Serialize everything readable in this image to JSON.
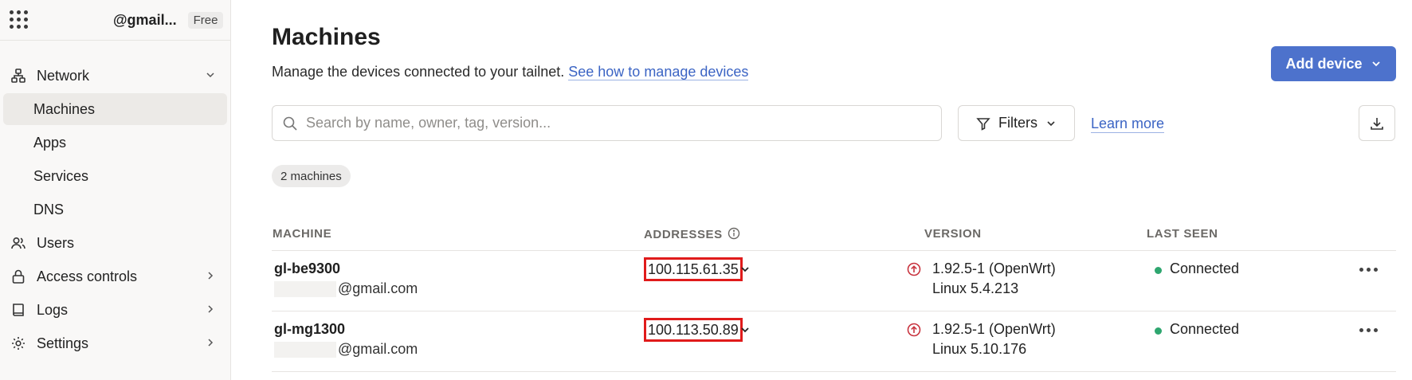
{
  "account": {
    "name": "@gmail...",
    "plan": "Free"
  },
  "sidebar": {
    "items": [
      {
        "label": "Network",
        "icon": "network-icon"
      },
      {
        "label": "Machines"
      },
      {
        "label": "Apps"
      },
      {
        "label": "Services"
      },
      {
        "label": "DNS"
      },
      {
        "label": "Users",
        "icon": "users-icon"
      },
      {
        "label": "Access controls",
        "icon": "lock-icon"
      },
      {
        "label": "Logs",
        "icon": "book-icon"
      },
      {
        "label": "Settings",
        "icon": "gear-icon"
      }
    ]
  },
  "header": {
    "title": "Machines",
    "subtitle": "Manage the devices connected to your tailnet.",
    "subtitle_link": "See how to manage devices",
    "add_button": "Add device"
  },
  "toolbar": {
    "search_placeholder": "Search by name, owner, tag, version...",
    "filters_label": "Filters",
    "learn_more": "Learn more"
  },
  "count_badge": "2 machines",
  "table": {
    "columns": [
      "MACHINE",
      "ADDRESSES",
      "VERSION",
      "LAST SEEN"
    ],
    "rows": [
      {
        "name": "gl-be9300",
        "owner": "@gmail.com",
        "address": "100.115.61.35",
        "version": "1.92.5-1 (OpenWrt)",
        "os": "Linux 5.4.213",
        "status": "Connected"
      },
      {
        "name": "gl-mg1300",
        "owner": "@gmail.com",
        "address": "100.113.50.89",
        "version": "1.92.5-1 (OpenWrt)",
        "os": "Linux 5.10.176",
        "status": "Connected"
      }
    ]
  },
  "colors": {
    "accent": "#4d72cc",
    "link": "#3b64c4",
    "highlight": "#e01b1b",
    "connected": "#2ea66f",
    "update": "#c8343f"
  }
}
